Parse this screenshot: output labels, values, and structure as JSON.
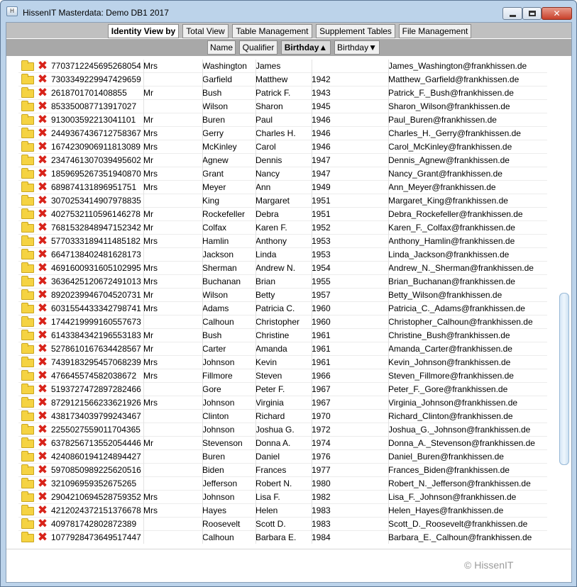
{
  "window": {
    "title": "HissenIT Masterdata: Demo DB1 2017"
  },
  "nav": {
    "identity_view": "Identity View by",
    "total_view": "Total View",
    "table_management": "Table Management",
    "supplement_tables": "Supplement Tables",
    "file_management": "File Management"
  },
  "sort": {
    "name": "Name",
    "qualifier": "Qualifier",
    "birthday_asc": "Birthday▲",
    "birthday_desc": "Birthday▼"
  },
  "rows": [
    {
      "id": "7703712245695268054",
      "q": "Mrs",
      "last": "Washington",
      "first": "James",
      "year": "",
      "mail": "James_Washington@frankhissen.de"
    },
    {
      "id": "7303349229947429659",
      "q": "",
      "last": "Garfield",
      "first": "Matthew",
      "year": "1942",
      "mail": "Matthew_Garfield@frankhissen.de"
    },
    {
      "id": "2618701701408855",
      "q": "Mr",
      "last": "Bush",
      "first": "Patrick F.",
      "year": "1943",
      "mail": "Patrick_F._Bush@frankhissen.de"
    },
    {
      "id": "853350087713917027",
      "q": "",
      "last": "Wilson",
      "first": "Sharon",
      "year": "1945",
      "mail": "Sharon_Wilson@frankhissen.de"
    },
    {
      "id": "913003592213041101",
      "q": "Mr",
      "last": "Buren",
      "first": "Paul",
      "year": "1946",
      "mail": "Paul_Buren@frankhissen.de"
    },
    {
      "id": "2449367436712758367",
      "q": "Mrs",
      "last": "Gerry",
      "first": "Charles H.",
      "year": "1946",
      "mail": "Charles_H._Gerry@frankhissen.de"
    },
    {
      "id": "1674230906911813089",
      "q": "Mrs",
      "last": "McKinley",
      "first": "Carol",
      "year": "1946",
      "mail": "Carol_McKinley@frankhissen.de"
    },
    {
      "id": "2347461307039495602",
      "q": "Mr",
      "last": "Agnew",
      "first": "Dennis",
      "year": "1947",
      "mail": "Dennis_Agnew@frankhissen.de"
    },
    {
      "id": "1859695267351940870",
      "q": "Mrs",
      "last": "Grant",
      "first": "Nancy",
      "year": "1947",
      "mail": "Nancy_Grant@frankhissen.de"
    },
    {
      "id": "689874131896951751",
      "q": "Mrs",
      "last": "Meyer",
      "first": "Ann",
      "year": "1949",
      "mail": "Ann_Meyer@frankhissen.de"
    },
    {
      "id": "3070253414907978835",
      "q": "",
      "last": "King",
      "first": "Margaret",
      "year": "1951",
      "mail": "Margaret_King@frankhissen.de"
    },
    {
      "id": "4027532110596146278",
      "q": "Mr",
      "last": "Rockefeller",
      "first": "Debra",
      "year": "1951",
      "mail": "Debra_Rockefeller@frankhissen.de"
    },
    {
      "id": "7681532848947152342",
      "q": "Mr",
      "last": "Colfax",
      "first": "Karen F.",
      "year": "1952",
      "mail": "Karen_F._Colfax@frankhissen.de"
    },
    {
      "id": "5770333189411485182",
      "q": "Mrs",
      "last": "Hamlin",
      "first": "Anthony",
      "year": "1953",
      "mail": "Anthony_Hamlin@frankhissen.de"
    },
    {
      "id": "6647138402481628173",
      "q": "",
      "last": "Jackson",
      "first": "Linda",
      "year": "1953",
      "mail": "Linda_Jackson@frankhissen.de"
    },
    {
      "id": "4691600931605102995",
      "q": "Mrs",
      "last": "Sherman",
      "first": "Andrew N.",
      "year": "1954",
      "mail": "Andrew_N._Sherman@frankhissen.de"
    },
    {
      "id": "3636425120672491013",
      "q": "Mrs",
      "last": "Buchanan",
      "first": "Brian",
      "year": "1955",
      "mail": "Brian_Buchanan@frankhissen.de"
    },
    {
      "id": "8920239946704520731",
      "q": "Mr",
      "last": "Wilson",
      "first": "Betty",
      "year": "1957",
      "mail": "Betty_Wilson@frankhissen.de"
    },
    {
      "id": "6031554433342798741",
      "q": "Mrs",
      "last": "Adams",
      "first": "Patricia C.",
      "year": "1960",
      "mail": "Patricia_C._Adams@frankhissen.de"
    },
    {
      "id": "1744219999160557673",
      "q": "",
      "last": "Calhoun",
      "first": "Christopher",
      "year": "1960",
      "mail": "Christopher_Calhoun@frankhissen.de"
    },
    {
      "id": "6143384342196553183",
      "q": "Mr",
      "last": "Bush",
      "first": "Christine",
      "year": "1961",
      "mail": "Christine_Bush@frankhissen.de"
    },
    {
      "id": "5278610167634428567",
      "q": "Mr",
      "last": "Carter",
      "first": "Amanda",
      "year": "1961",
      "mail": "Amanda_Carter@frankhissen.de"
    },
    {
      "id": "7439183295457068239",
      "q": "Mrs",
      "last": "Johnson",
      "first": "Kevin",
      "year": "1961",
      "mail": "Kevin_Johnson@frankhissen.de"
    },
    {
      "id": "476645574582038672",
      "q": "Mrs",
      "last": "Fillmore",
      "first": "Steven",
      "year": "1966",
      "mail": "Steven_Fillmore@frankhissen.de"
    },
    {
      "id": "5193727472897282466",
      "q": "",
      "last": "Gore",
      "first": "Peter F.",
      "year": "1967",
      "mail": "Peter_F._Gore@frankhissen.de"
    },
    {
      "id": "8729121566233621926",
      "q": "Mrs",
      "last": "Johnson",
      "first": "Virginia",
      "year": "1967",
      "mail": "Virginia_Johnson@frankhissen.de"
    },
    {
      "id": "4381734039799243467",
      "q": "",
      "last": "Clinton",
      "first": "Richard",
      "year": "1970",
      "mail": "Richard_Clinton@frankhissen.de"
    },
    {
      "id": "2255027559011704365",
      "q": "",
      "last": "Johnson",
      "first": "Joshua G.",
      "year": "1972",
      "mail": "Joshua_G._Johnson@frankhissen.de"
    },
    {
      "id": "6378256713552054446",
      "q": "Mr",
      "last": "Stevenson",
      "first": "Donna A.",
      "year": "1974",
      "mail": "Donna_A._Stevenson@frankhissen.de"
    },
    {
      "id": "4240860194124894427",
      "q": "",
      "last": "Buren",
      "first": "Daniel",
      "year": "1976",
      "mail": "Daniel_Buren@frankhissen.de"
    },
    {
      "id": "5970850989225620516",
      "q": "",
      "last": "Biden",
      "first": "Frances",
      "year": "1977",
      "mail": "Frances_Biden@frankhissen.de"
    },
    {
      "id": "321096959352675265",
      "q": "",
      "last": "Jefferson",
      "first": "Robert N.",
      "year": "1980",
      "mail": "Robert_N._Jefferson@frankhissen.de"
    },
    {
      "id": "2904210694528759352",
      "q": "Mrs",
      "last": "Johnson",
      "first": "Lisa F.",
      "year": "1982",
      "mail": "Lisa_F._Johnson@frankhissen.de"
    },
    {
      "id": "4212024372151376678",
      "q": "Mrs",
      "last": "Hayes",
      "first": "Helen",
      "year": "1983",
      "mail": "Helen_Hayes@frankhissen.de"
    },
    {
      "id": "409781742802872389",
      "q": "",
      "last": "Roosevelt",
      "first": "Scott D.",
      "year": "1983",
      "mail": "Scott_D._Roosevelt@frankhissen.de"
    },
    {
      "id": "1077928473649517447",
      "q": "",
      "last": "Calhoun",
      "first": "Barbara E.",
      "year": "1984",
      "mail": "Barbara_E._Calhoun@frankhissen.de"
    }
  ],
  "footer": {
    "copyright": "© HissenIT"
  }
}
